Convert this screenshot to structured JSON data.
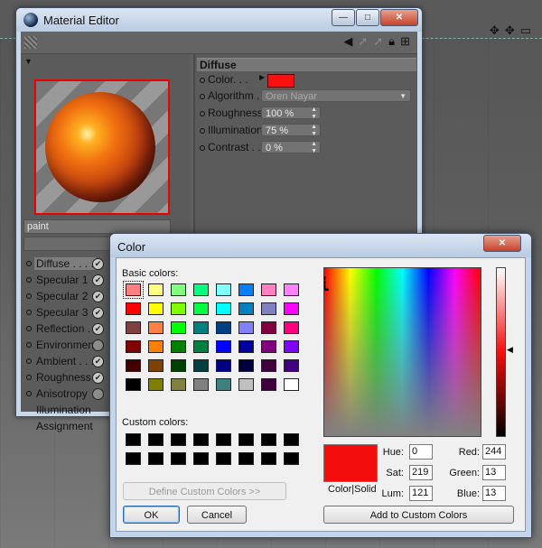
{
  "material_editor": {
    "title": "Material Editor",
    "material_name": "paint",
    "channels": [
      {
        "label": "Diffuse . . . .",
        "checked": true,
        "selected": true
      },
      {
        "label": "Specular 1",
        "checked": true
      },
      {
        "label": "Specular 2",
        "checked": true
      },
      {
        "label": "Specular 3",
        "checked": true
      },
      {
        "label": "Reflection . .",
        "checked": true
      },
      {
        "label": "Environment",
        "checked": false
      },
      {
        "label": "Ambient . . .",
        "checked": true
      },
      {
        "label": "Roughness",
        "checked": true
      },
      {
        "label": "Anisotropy",
        "checked": false
      },
      {
        "label": "Illumination"
      },
      {
        "label": "Assignment"
      }
    ],
    "panel": {
      "section_title": "Diffuse",
      "color_label": "Color. . .",
      "color_value": "#ff1010",
      "algorithm_label": "Algorithm .",
      "algorithm_value": "Oren Nayar",
      "roughness_label": "Roughness",
      "roughness_value": "100 %",
      "illumination_label": "Illumination",
      "illumination_value": "75 %",
      "contrast_label": "Contrast . .",
      "contrast_value": "0 %"
    }
  },
  "color_dialog": {
    "title": "Color",
    "basic_colors_label": "Basic colors:",
    "basic_colors": [
      "#ff8080",
      "#ffff80",
      "#80ff80",
      "#00ff80",
      "#80ffff",
      "#0080ff",
      "#ff80c0",
      "#ff80ff",
      "#ff0000",
      "#ffff00",
      "#80ff00",
      "#00ff40",
      "#00ffff",
      "#0080c0",
      "#8080c0",
      "#ff00ff",
      "#804040",
      "#ff8040",
      "#00ff00",
      "#008080",
      "#004080",
      "#8080ff",
      "#800040",
      "#ff0080",
      "#800000",
      "#ff8000",
      "#008000",
      "#008040",
      "#0000ff",
      "#0000a0",
      "#800080",
      "#8000ff",
      "#400000",
      "#804000",
      "#004000",
      "#004040",
      "#000080",
      "#000040",
      "#400040",
      "#400080",
      "#000000",
      "#808000",
      "#808040",
      "#808080",
      "#408080",
      "#c0c0c0",
      "#400040",
      "#ffffff"
    ],
    "custom_colors_label": "Custom colors:",
    "custom_colors": [
      "#000000",
      "#000000",
      "#000000",
      "#000000",
      "#000000",
      "#000000",
      "#000000",
      "#000000",
      "#000000",
      "#000000",
      "#000000",
      "#000000",
      "#000000",
      "#000000",
      "#000000",
      "#000000"
    ],
    "define_custom_label": "Define Custom Colors >>",
    "ok_label": "OK",
    "cancel_label": "Cancel",
    "color_solid_label": "Color|Solid",
    "hue_label": "Hue:",
    "hue_value": "0",
    "sat_label": "Sat:",
    "sat_value": "219",
    "lum_label": "Lum:",
    "lum_value": "121",
    "red_label": "Red:",
    "red_value": "244",
    "green_label": "Green:",
    "green_value": "13",
    "blue_label": "Blue:",
    "blue_value": "13",
    "add_custom_label": "Add to Custom Colors",
    "current_color": "#f40d0d"
  }
}
